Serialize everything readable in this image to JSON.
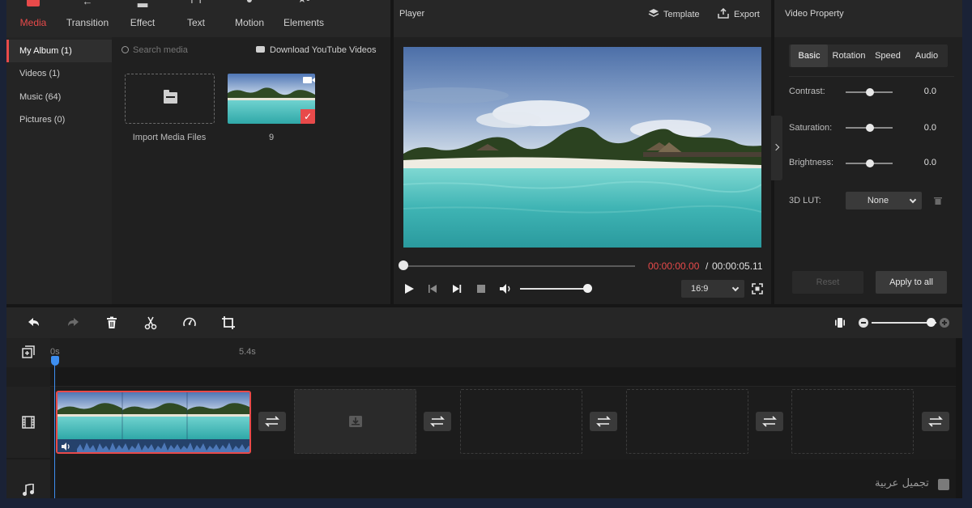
{
  "top_tabs": [
    {
      "label": "Media",
      "icon": "▬"
    },
    {
      "label": "Transition",
      "icon": "←"
    },
    {
      "label": "Effect",
      "icon": "▂"
    },
    {
      "label": "Text",
      "icon": "T"
    },
    {
      "label": "Motion",
      "icon": "●"
    },
    {
      "label": "Elements",
      "icon": "★"
    }
  ],
  "album": {
    "items": [
      "My Album (1)",
      "Videos (1)",
      "Music (64)",
      "Pictures (0)"
    ],
    "active_index": 0
  },
  "media": {
    "search_placeholder": "Search media",
    "youtube_label": "Download YouTube Videos",
    "import_label": "Import Media Files",
    "thumb_label": "9"
  },
  "player": {
    "title": "Player",
    "template_label": "Template",
    "export_label": "Export",
    "time_current": "00:00:00.00",
    "time_sep": "/",
    "time_total": "00:00:05.11",
    "aspect_ratio": "16:9",
    "progress": 0,
    "volume": 1.0
  },
  "property": {
    "title": "Video Property",
    "tabs": [
      "Basic",
      "Rotation",
      "Speed",
      "Audio"
    ],
    "active_tab": 0,
    "rows": [
      {
        "label": "Contrast:",
        "value": "0.0"
      },
      {
        "label": "Saturation:",
        "value": "0.0"
      },
      {
        "label": "Brightness:",
        "value": "0.0"
      }
    ],
    "lut_label": "3D LUT:",
    "lut_value": "None",
    "reset_label": "Reset",
    "apply_label": "Apply to all"
  },
  "timeline": {
    "ticks": [
      "0s",
      "5.4s"
    ],
    "zoom": 0.85
  },
  "watermark": "تجميل عربية",
  "colors": {
    "accent": "#e84a4a",
    "playhead": "#3d8ef0"
  }
}
